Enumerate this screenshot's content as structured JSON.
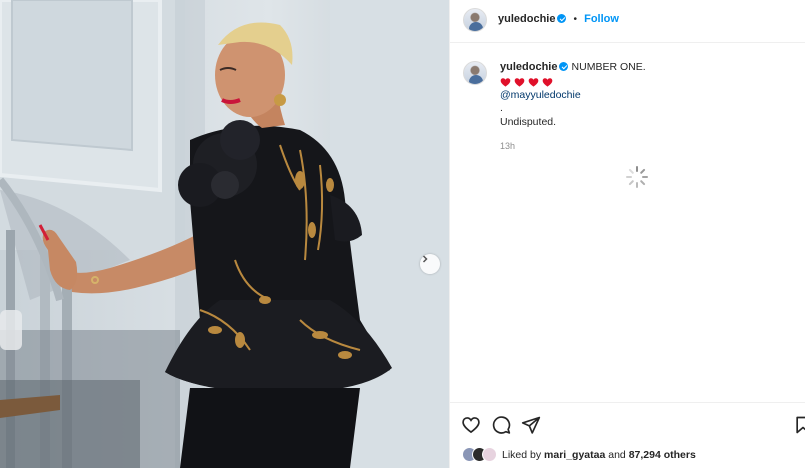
{
  "post": {
    "author": "yuledochie",
    "follow_label": "Follow",
    "separator": "•",
    "caption": {
      "text": "NUMBER ONE.",
      "hearts": 4,
      "heart_color": "#e0102a",
      "mention": "@mayyuledochie",
      "line2": ".",
      "line3": "Undisputed."
    },
    "time": "13h",
    "likes": {
      "prefix": "Liked by",
      "user": "mari_gyataa",
      "middle": "and",
      "count": "87,294 others"
    }
  },
  "icons": {
    "verified": "verified-badge-icon",
    "like": "heart-icon",
    "comment": "comment-icon",
    "share": "send-icon",
    "save": "bookmark-icon",
    "next": "chevron-right-icon",
    "loading": "loading-spinner-icon"
  },
  "colors": {
    "accent": "#0095f6",
    "link": "#00376b",
    "muted": "#8e8e8e",
    "dress": "#15161a",
    "embroidery": "#b9893f"
  }
}
